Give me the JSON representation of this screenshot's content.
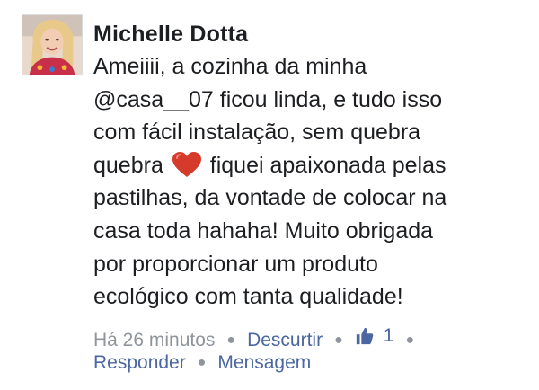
{
  "comment": {
    "author": "Michelle Dotta",
    "text_lines": [
      "Ameiiii, a cozinha da minha",
      "@casa__07 ficou linda, e tudo isso",
      "com fácil instalação, sem quebra",
      "quebra",
      "fiquei apaixonada pelas",
      "pastilhas, da vontade de colocar na",
      "casa toda hahaha! Muito obrigada",
      "por proporcionar um produto",
      "ecológico com tanta qualidade!"
    ],
    "timestamp": "Há 26 minutos",
    "unlike_label": "Descurtir",
    "like_count": "1",
    "reply_label": "Responder",
    "message_label": "Mensagem"
  },
  "icons": {
    "heart": "heart-emoji",
    "like": "thumbs-up-icon"
  },
  "colors": {
    "link": "#4b67a1",
    "meta": "#90949c",
    "heart": "#d63a2a"
  }
}
